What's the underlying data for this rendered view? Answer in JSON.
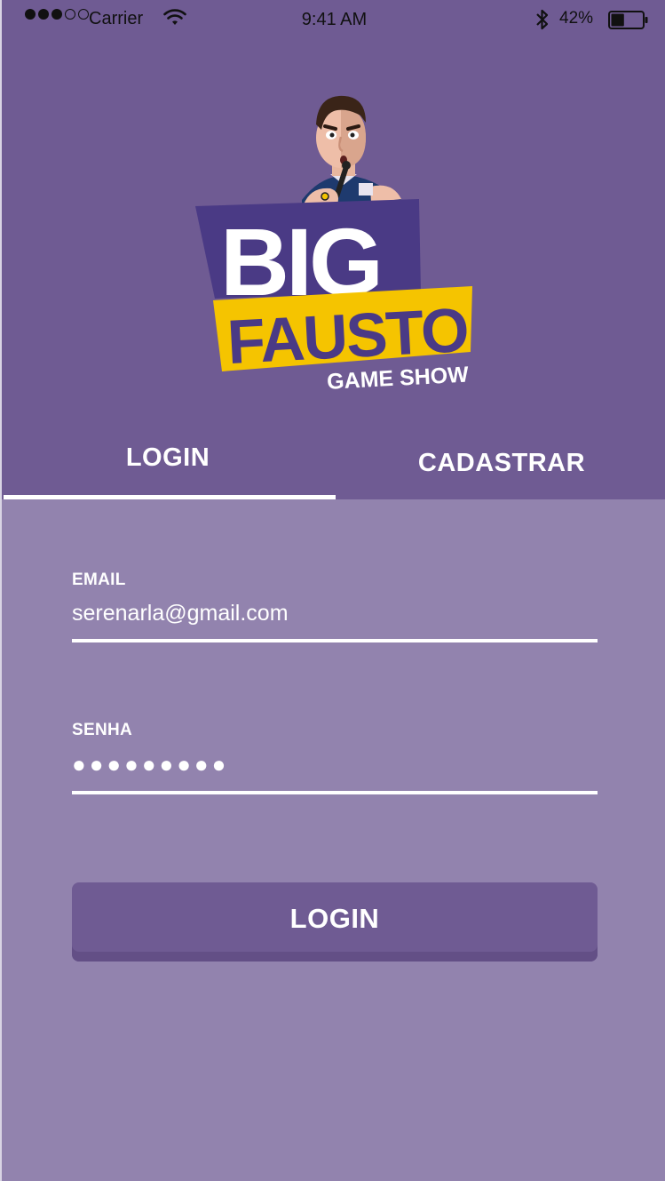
{
  "status_bar": {
    "carrier": "Carrier",
    "time": "9:41 AM",
    "battery_pct": "42%",
    "battery_level": 0.42,
    "signal_bars_filled": 3,
    "signal_bars_total": 5,
    "icons": [
      "wifi-icon",
      "bluetooth-icon",
      "battery-icon"
    ]
  },
  "logo": {
    "line1": "BIG",
    "line2": "FAUSTO",
    "line3": "GAME SHOW"
  },
  "tabs": [
    {
      "label": "LOGIN",
      "active": true
    },
    {
      "label": "CADASTRAR",
      "active": false
    }
  ],
  "form": {
    "email": {
      "label": "EMAIL",
      "value": "serenarla@gmail.com"
    },
    "senha": {
      "label": "SENHA",
      "value": "●●●●●●●●●"
    },
    "submit_label": "LOGIN"
  },
  "colors": {
    "header_bg": "#6f5b93",
    "body_bg": "#9283ae",
    "logo_purple": "#4a3a85",
    "logo_yellow": "#f5c400"
  }
}
